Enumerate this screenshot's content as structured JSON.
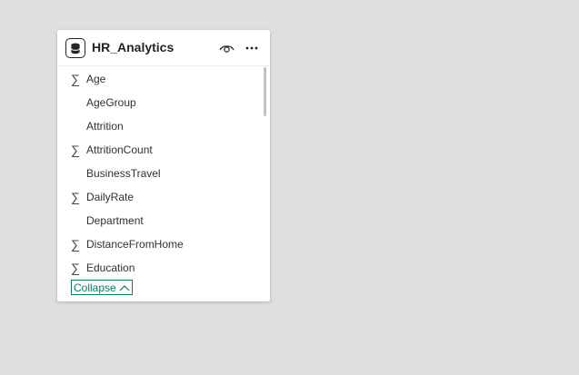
{
  "table_card": {
    "title": "HR_Analytics",
    "icon": "database-icon",
    "actions": [
      {
        "name": "eye-icon"
      },
      {
        "name": "more-icon"
      }
    ],
    "fields": [
      {
        "label": "Age",
        "aggregate": true
      },
      {
        "label": "AgeGroup",
        "aggregate": false
      },
      {
        "label": "Attrition",
        "aggregate": false
      },
      {
        "label": "AttritionCount",
        "aggregate": true
      },
      {
        "label": "BusinessTravel",
        "aggregate": false
      },
      {
        "label": "DailyRate",
        "aggregate": true
      },
      {
        "label": "Department",
        "aggregate": false
      },
      {
        "label": "DistanceFromHome",
        "aggregate": true
      },
      {
        "label": "Education",
        "aggregate": true
      }
    ],
    "sigma_symbol": "∑",
    "collapse_label": "Collapse",
    "accent_color": "#117865"
  }
}
